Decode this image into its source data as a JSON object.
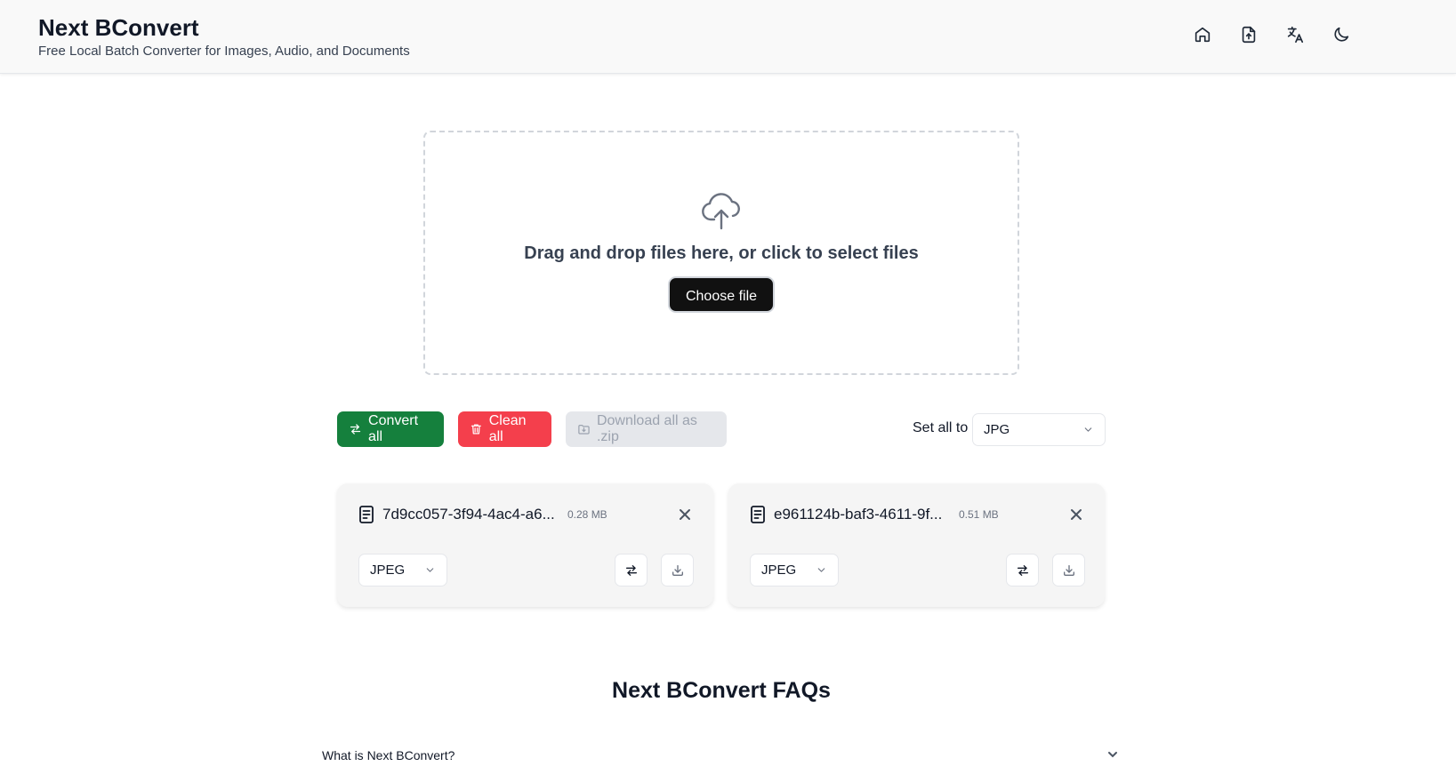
{
  "header": {
    "title": "Next BConvert",
    "subtitle": "Free Local Batch Converter for Images, Audio, and Documents",
    "icons": [
      "home-icon",
      "file-upload-icon",
      "translate-icon",
      "moon-icon"
    ]
  },
  "dropzone": {
    "text": "Drag and drop files here, or click to select files",
    "choose_label": "Choose file"
  },
  "toolbar": {
    "convert_all": "Convert all",
    "clean_all": "Clean all",
    "download_zip": "Download all as .zip",
    "set_all_label": "Set all to",
    "set_all_value": "JPG"
  },
  "files": [
    {
      "name": "7d9cc057-3f94-4ac4-a6...",
      "size": "0.28 MB",
      "format": "JPEG"
    },
    {
      "name": "e961124b-baf3-4611-9f...",
      "size": "0.51 MB",
      "format": "JPEG"
    }
  ],
  "faq": {
    "title": "Next BConvert FAQs",
    "items": [
      {
        "question": "What is Next BConvert?"
      }
    ]
  },
  "colors": {
    "convert": "#15803d",
    "clean": "#f43f4c",
    "download_disabled": "#e5e7eb",
    "primary_button": "#111111"
  }
}
